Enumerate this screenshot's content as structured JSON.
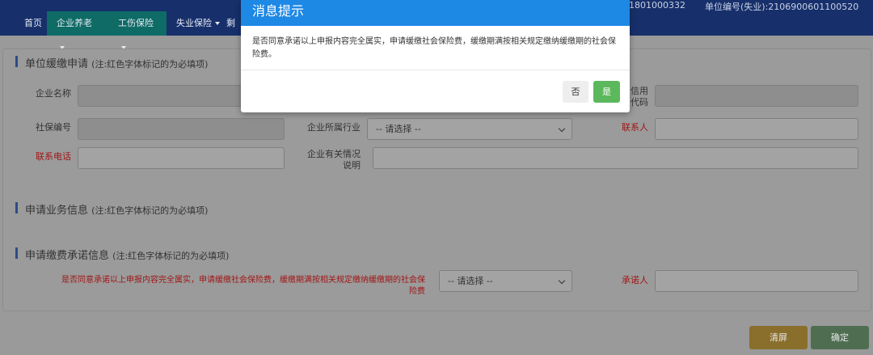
{
  "nav": {
    "home": "首页",
    "items": [
      "企业养老",
      "工伤保险",
      "失业保险",
      "剩"
    ],
    "code1": "1801000332",
    "code2": "单位编号(失业):2106900601100520"
  },
  "section1": {
    "title": "单位缓缴申请",
    "note": "(注:红色字体标记的为必填项)",
    "company_name_label": "企业名称",
    "credit_code_label_line1": "信用",
    "credit_code_label_line2": "代码",
    "social_no_label": "社保编号",
    "industry_label": "企业所属行业",
    "industry_value": "-- 请选择 --",
    "contact_label": "联系人",
    "phone_label": "联系电话",
    "desc_label_line1": "企业有关情况",
    "desc_label_line2": "说明"
  },
  "section2": {
    "title": "申请业务信息",
    "note": "(注:红色字体标记的为必填项)"
  },
  "section3": {
    "title": "申请缴费承诺信息",
    "note": "(注:红色字体标记的为必填项)",
    "promise_label_line1": "是否同意承诺以上申报内容完全属实，申请缓缴社会保险费，缓缴期满按相关规定缴纳缓缴期的社会保",
    "promise_label_line2": "险费",
    "promise_value": "-- 请选择 --",
    "promiser_label": "承诺人"
  },
  "buttons": {
    "clear": "清屏",
    "confirm": "确定"
  },
  "modal": {
    "title": "消息提示",
    "message": "是否同意承诺以上申报内容完全属实，申请缓缴社会保险费，缓缴期满按相关规定缴纳缓缴期的社会保险费。",
    "no": "否",
    "yes": "是"
  }
}
